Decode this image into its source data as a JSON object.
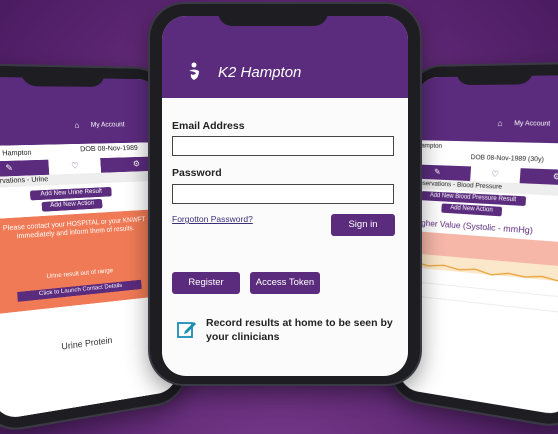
{
  "center": {
    "app_title": "K2 Hampton",
    "email_label": "Email Address",
    "email_value": "",
    "password_label": "Password",
    "password_value": "",
    "forgot_link": "Forgotton Password?",
    "signin_button": "Sign in",
    "register_button": "Register",
    "token_button": "Access Token",
    "footer_text": "Record results at home to be seen by your clinicians",
    "colors": {
      "brand": "#5b2b7d",
      "background": "#5a2470"
    }
  },
  "left": {
    "account": "My Account",
    "patient": "TEST, Hampton",
    "dob": "DOB 08-Nov-1989",
    "section": "Observations - Urine",
    "add_result": "Add New Urine Result",
    "add_action": "Add New Action",
    "alert_text": "Please contact your HOSPITAL or your KNWFT immediately and inform them of results.",
    "alert_sub": "Urine result out of range",
    "alert_button": "Click to Launch Contact Details",
    "protein": "Urine Protein"
  },
  "right": {
    "account": "My Account",
    "patient": "Hampton",
    "dob": "DOB 08-Nov-1989 (30y)",
    "section": "Observations - Blood Pressure",
    "add_result": "Add New Blood Pressure Result",
    "add_action": "Add New Action",
    "chart_title": "Higher Value (Systolic - mmHg)"
  }
}
